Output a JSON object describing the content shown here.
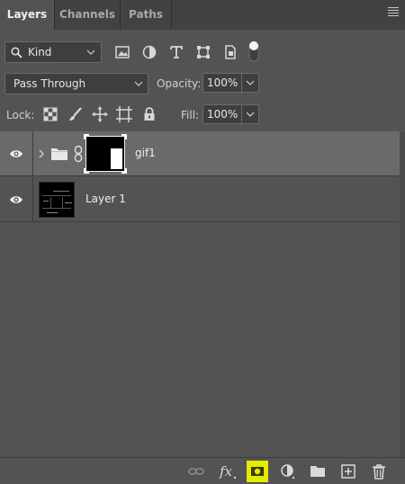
{
  "tabs": [
    {
      "label": "Layers",
      "active": true
    },
    {
      "label": "Channels",
      "active": false
    },
    {
      "label": "Paths",
      "active": false
    }
  ],
  "filter": {
    "kind_label": "Kind",
    "icons": [
      "image-filter-icon",
      "adjustment-filter-icon",
      "type-filter-icon",
      "shape-filter-icon",
      "smart-object-filter-icon",
      "filter-toggle-icon"
    ]
  },
  "blend": {
    "mode": "Pass Through",
    "opacity_label": "Opacity:",
    "opacity_value": "100%"
  },
  "lock": {
    "label": "Lock:",
    "icons": [
      "lock-transparent-pixels-icon",
      "lock-image-pixels-icon",
      "lock-position-icon",
      "lock-artboard-icon",
      "lock-all-icon"
    ],
    "fill_label": "Fill:",
    "fill_value": "100%"
  },
  "layers": [
    {
      "name": "gif1",
      "type": "group",
      "selected": true,
      "visible": true
    },
    {
      "name": "Layer 1",
      "type": "pixel",
      "selected": false,
      "visible": true
    }
  ],
  "bottom_icons": [
    "link-layers-icon",
    "fx-icon",
    "add-mask-icon",
    "adjustment-layer-icon",
    "new-group-icon",
    "new-layer-icon",
    "delete-icon"
  ],
  "colors": {
    "panel_bg": "#535353",
    "tab_bar": "#424242",
    "selected_row": "#6a6a6a",
    "highlight": "#e4ea00"
  }
}
